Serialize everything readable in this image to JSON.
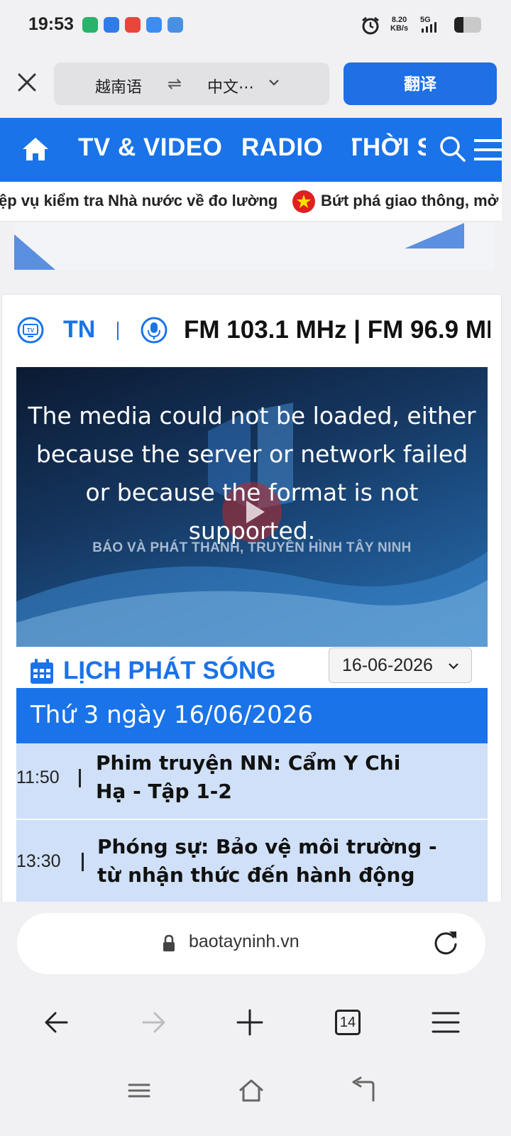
{
  "status_bar": {
    "time": "19:53",
    "net_speed_value": "8.20",
    "net_speed_unit": "KB/s",
    "network": "5G",
    "battery_level": 0.35,
    "app_icons": [
      "wifi-app-icon",
      "browser-app-icon",
      "video-app-icon",
      "vivo-app-icon",
      "files-app-icon"
    ]
  },
  "translate_bar": {
    "source_language": "越南语",
    "swap_symbol": "⇌",
    "target_language": "中文⋯",
    "translate_button": "翻译"
  },
  "site_nav": {
    "items": [
      "TV & VIDEO",
      "RADIO",
      "THỜI S"
    ]
  },
  "ticker": {
    "items": [
      "ệp vụ kiểm tra Nhà nước về đo lường",
      "Bứt phá giao thông, mở rộ"
    ]
  },
  "channel": {
    "tv_label": "TV",
    "name": "TN",
    "frequencies": "FM 103.1 MHz | FM 96.9 MI"
  },
  "player": {
    "error_message": "The media could not be loaded, either because the server or network failed or because the format is not supported.",
    "station_line": "BÁO VÀ PHÁT THANH, TRUYỀN HÌNH TÂY NINH"
  },
  "schedule": {
    "title": "LỊCH PHÁT SÓNG",
    "selected_date": "16-06-2026",
    "day_heading": "Thứ 3 ngày 16/06/2026",
    "rows": [
      {
        "time": "11:50",
        "title": "Phim truyện NN: Cẩm Y Chi Hạ - Tập 1-2"
      },
      {
        "time": "13:30",
        "title": "Phóng sự: Bảo vệ môi trường - từ nhận thức đến hành động"
      }
    ]
  },
  "address_bar": {
    "url": "baotayninh.vn"
  },
  "toolbar": {
    "tab_count": "14"
  },
  "colors": {
    "brand_blue": "#1a73e8",
    "translate_button": "#1f6fe5",
    "row_background": "#cfe0f8"
  }
}
